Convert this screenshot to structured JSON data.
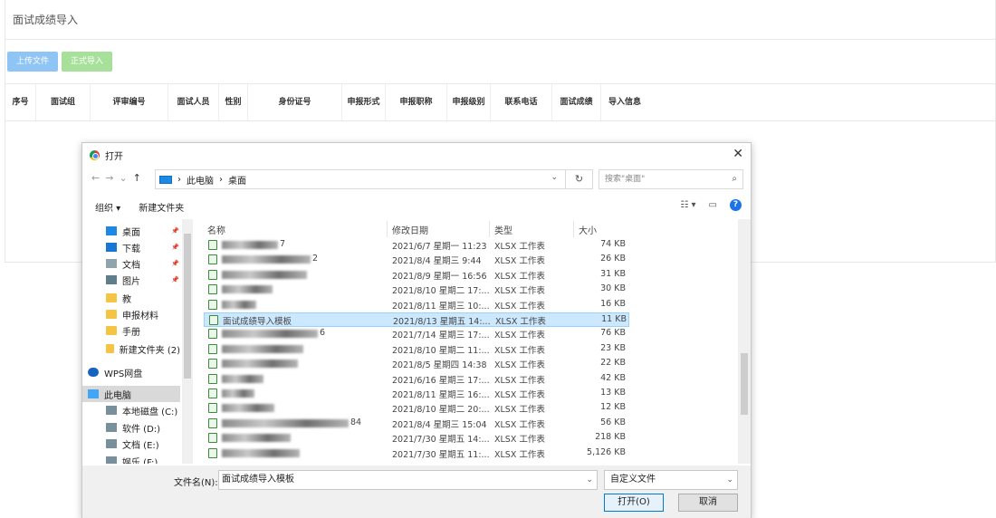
{
  "page": {
    "title": "面试成绩导入",
    "upload_btn": "上传文件",
    "import_btn": "正式导入",
    "columns": [
      "序号",
      "面试组",
      "评审编号",
      "面试人员",
      "性别",
      "身份证号",
      "申报形式",
      "申报职称",
      "申报级别",
      "联系电话",
      "面试成绩",
      "导入信息"
    ]
  },
  "dialog": {
    "title": "打开",
    "close": "✕",
    "breadcrumb": [
      "此电脑",
      "桌面"
    ],
    "search_placeholder": "搜索\"桌面\"",
    "organize": "组织 ▾",
    "new_folder": "新建文件夹",
    "nav": [
      {
        "label": "桌面",
        "icon": "desktop-icon",
        "pin": true
      },
      {
        "label": "下载",
        "icon": "download-icon",
        "pin": true
      },
      {
        "label": "文档",
        "icon": "document-icon",
        "pin": true
      },
      {
        "label": "图片",
        "icon": "picture-icon",
        "pin": true
      },
      {
        "label": "教",
        "icon": "folder-icon",
        "pin": false
      },
      {
        "label": "申报材料",
        "icon": "folder-icon",
        "pin": false
      },
      {
        "label": "手册",
        "icon": "folder-icon",
        "pin": false
      },
      {
        "label": "新建文件夹 (2)",
        "icon": "folder-icon",
        "pin": false
      },
      {
        "label": "WPS网盘",
        "icon": "cloud-icon",
        "pin": false
      },
      {
        "label": "此电脑",
        "icon": "pc-icon",
        "pin": false,
        "selected": true
      },
      {
        "label": "本地磁盘 (C:)",
        "icon": "drive-icon",
        "pin": false
      },
      {
        "label": "软件 (D:)",
        "icon": "drive-icon",
        "pin": false
      },
      {
        "label": "文档 (E:)",
        "icon": "drive-icon",
        "pin": false
      },
      {
        "label": "娱乐 (F:)",
        "icon": "drive-icon",
        "pin": false
      }
    ],
    "headers": {
      "name": "名称",
      "date": "修改日期",
      "type": "类型",
      "size": "大小"
    },
    "files": [
      {
        "name": "",
        "blur_width": 62,
        "suffix": "7",
        "date": "2021/6/7 星期一 11:23",
        "type": "XLSX 工作表",
        "size": "74 KB"
      },
      {
        "name": "",
        "blur_width": 98,
        "suffix": "2",
        "date": "2021/8/4 星期三 9:44",
        "type": "XLSX 工作表",
        "size": "26 KB"
      },
      {
        "name": "",
        "blur_width": 94,
        "suffix": "",
        "date": "2021/8/9 星期一 16:56",
        "type": "XLSX 工作表",
        "size": "31 KB"
      },
      {
        "name": "",
        "blur_width": 56,
        "suffix": "",
        "date": "2021/8/10 星期二 17:...",
        "type": "XLSX 工作表",
        "size": "30 KB"
      },
      {
        "name": "",
        "blur_width": 38,
        "suffix": "",
        "date": "2021/8/11 星期三 10:...",
        "type": "XLSX 工作表",
        "size": "16 KB"
      },
      {
        "name": "面试成绩导入模板",
        "blur_width": 0,
        "suffix": "",
        "date": "2021/8/13 星期五 14:...",
        "type": "XLSX 工作表",
        "size": "11 KB",
        "selected": true
      },
      {
        "name": "",
        "blur_width": 106,
        "suffix": "6",
        "date": "2021/7/14 星期三 17:...",
        "type": "XLSX 工作表",
        "size": "76 KB"
      },
      {
        "name": "",
        "blur_width": 90,
        "suffix": "",
        "date": "2021/8/10 星期二 11:...",
        "type": "XLSX 工作表",
        "size": "23 KB"
      },
      {
        "name": "",
        "blur_width": 84,
        "suffix": "",
        "date": "2021/8/5 星期四 14:38",
        "type": "XLSX 工作表",
        "size": "22 KB"
      },
      {
        "name": "",
        "blur_width": 46,
        "suffix": "",
        "date": "2021/6/16 星期三 17:...",
        "type": "XLSX 工作表",
        "size": "42 KB"
      },
      {
        "name": "",
        "blur_width": 36,
        "suffix": "",
        "date": "2021/8/11 星期三 16:...",
        "type": "XLSX 工作表",
        "size": "13 KB"
      },
      {
        "name": "",
        "blur_width": 58,
        "suffix": "",
        "date": "2021/8/10 星期二 20:...",
        "type": "XLSX 工作表",
        "size": "12 KB"
      },
      {
        "name": "",
        "blur_width": 140,
        "suffix": "84",
        "date": "2021/8/4 星期三 15:04",
        "type": "XLSX 工作表",
        "size": "56 KB"
      },
      {
        "name": "",
        "blur_width": 76,
        "suffix": "",
        "date": "2021/7/30 星期五 14:...",
        "type": "XLSX 工作表",
        "size": "218 KB"
      },
      {
        "name": "",
        "blur_width": 86,
        "suffix": "",
        "date": "2021/7/30 星期五 11:...",
        "type": "XLSX 工作表",
        "size": "5,126 KB"
      }
    ],
    "filename_label": "文件名(N):",
    "filename_value": "面试成绩导入模板",
    "filter_value": "自定义文件",
    "open_btn": "打开(O)",
    "cancel_btn": "取消"
  }
}
